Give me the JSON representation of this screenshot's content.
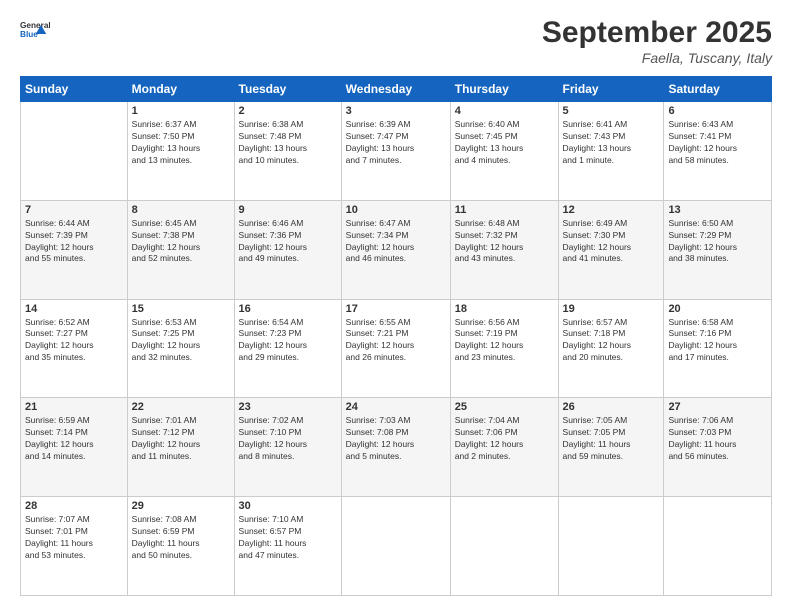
{
  "header": {
    "logo_line1": "General",
    "logo_line2": "Blue",
    "month": "September 2025",
    "location": "Faella, Tuscany, Italy"
  },
  "weekdays": [
    "Sunday",
    "Monday",
    "Tuesday",
    "Wednesday",
    "Thursday",
    "Friday",
    "Saturday"
  ],
  "weeks": [
    [
      {
        "day": "",
        "info": ""
      },
      {
        "day": "1",
        "info": "Sunrise: 6:37 AM\nSunset: 7:50 PM\nDaylight: 13 hours\nand 13 minutes."
      },
      {
        "day": "2",
        "info": "Sunrise: 6:38 AM\nSunset: 7:48 PM\nDaylight: 13 hours\nand 10 minutes."
      },
      {
        "day": "3",
        "info": "Sunrise: 6:39 AM\nSunset: 7:47 PM\nDaylight: 13 hours\nand 7 minutes."
      },
      {
        "day": "4",
        "info": "Sunrise: 6:40 AM\nSunset: 7:45 PM\nDaylight: 13 hours\nand 4 minutes."
      },
      {
        "day": "5",
        "info": "Sunrise: 6:41 AM\nSunset: 7:43 PM\nDaylight: 13 hours\nand 1 minute."
      },
      {
        "day": "6",
        "info": "Sunrise: 6:43 AM\nSunset: 7:41 PM\nDaylight: 12 hours\nand 58 minutes."
      }
    ],
    [
      {
        "day": "7",
        "info": "Sunrise: 6:44 AM\nSunset: 7:39 PM\nDaylight: 12 hours\nand 55 minutes."
      },
      {
        "day": "8",
        "info": "Sunrise: 6:45 AM\nSunset: 7:38 PM\nDaylight: 12 hours\nand 52 minutes."
      },
      {
        "day": "9",
        "info": "Sunrise: 6:46 AM\nSunset: 7:36 PM\nDaylight: 12 hours\nand 49 minutes."
      },
      {
        "day": "10",
        "info": "Sunrise: 6:47 AM\nSunset: 7:34 PM\nDaylight: 12 hours\nand 46 minutes."
      },
      {
        "day": "11",
        "info": "Sunrise: 6:48 AM\nSunset: 7:32 PM\nDaylight: 12 hours\nand 43 minutes."
      },
      {
        "day": "12",
        "info": "Sunrise: 6:49 AM\nSunset: 7:30 PM\nDaylight: 12 hours\nand 41 minutes."
      },
      {
        "day": "13",
        "info": "Sunrise: 6:50 AM\nSunset: 7:29 PM\nDaylight: 12 hours\nand 38 minutes."
      }
    ],
    [
      {
        "day": "14",
        "info": "Sunrise: 6:52 AM\nSunset: 7:27 PM\nDaylight: 12 hours\nand 35 minutes."
      },
      {
        "day": "15",
        "info": "Sunrise: 6:53 AM\nSunset: 7:25 PM\nDaylight: 12 hours\nand 32 minutes."
      },
      {
        "day": "16",
        "info": "Sunrise: 6:54 AM\nSunset: 7:23 PM\nDaylight: 12 hours\nand 29 minutes."
      },
      {
        "day": "17",
        "info": "Sunrise: 6:55 AM\nSunset: 7:21 PM\nDaylight: 12 hours\nand 26 minutes."
      },
      {
        "day": "18",
        "info": "Sunrise: 6:56 AM\nSunset: 7:19 PM\nDaylight: 12 hours\nand 23 minutes."
      },
      {
        "day": "19",
        "info": "Sunrise: 6:57 AM\nSunset: 7:18 PM\nDaylight: 12 hours\nand 20 minutes."
      },
      {
        "day": "20",
        "info": "Sunrise: 6:58 AM\nSunset: 7:16 PM\nDaylight: 12 hours\nand 17 minutes."
      }
    ],
    [
      {
        "day": "21",
        "info": "Sunrise: 6:59 AM\nSunset: 7:14 PM\nDaylight: 12 hours\nand 14 minutes."
      },
      {
        "day": "22",
        "info": "Sunrise: 7:01 AM\nSunset: 7:12 PM\nDaylight: 12 hours\nand 11 minutes."
      },
      {
        "day": "23",
        "info": "Sunrise: 7:02 AM\nSunset: 7:10 PM\nDaylight: 12 hours\nand 8 minutes."
      },
      {
        "day": "24",
        "info": "Sunrise: 7:03 AM\nSunset: 7:08 PM\nDaylight: 12 hours\nand 5 minutes."
      },
      {
        "day": "25",
        "info": "Sunrise: 7:04 AM\nSunset: 7:06 PM\nDaylight: 12 hours\nand 2 minutes."
      },
      {
        "day": "26",
        "info": "Sunrise: 7:05 AM\nSunset: 7:05 PM\nDaylight: 11 hours\nand 59 minutes."
      },
      {
        "day": "27",
        "info": "Sunrise: 7:06 AM\nSunset: 7:03 PM\nDaylight: 11 hours\nand 56 minutes."
      }
    ],
    [
      {
        "day": "28",
        "info": "Sunrise: 7:07 AM\nSunset: 7:01 PM\nDaylight: 11 hours\nand 53 minutes."
      },
      {
        "day": "29",
        "info": "Sunrise: 7:08 AM\nSunset: 6:59 PM\nDaylight: 11 hours\nand 50 minutes."
      },
      {
        "day": "30",
        "info": "Sunrise: 7:10 AM\nSunset: 6:57 PM\nDaylight: 11 hours\nand 47 minutes."
      },
      {
        "day": "",
        "info": ""
      },
      {
        "day": "",
        "info": ""
      },
      {
        "day": "",
        "info": ""
      },
      {
        "day": "",
        "info": ""
      }
    ]
  ]
}
